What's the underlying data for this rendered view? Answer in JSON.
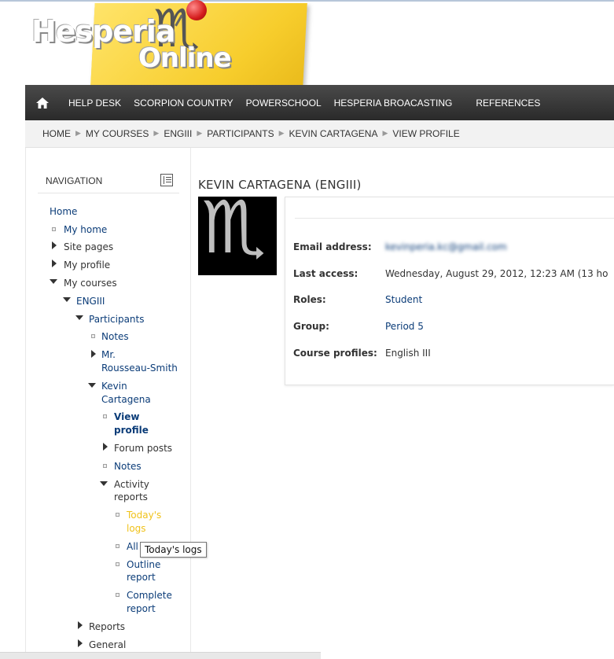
{
  "logo": {
    "line1": "Hesperia",
    "line2": "Online"
  },
  "navbar": {
    "items": [
      "HELP DESK",
      "SCORPION COUNTRY",
      "POWERSCHOOL",
      "HESPERIA BROACASTING",
      "REFERENCES"
    ]
  },
  "breadcrumb": [
    "HOME",
    "MY COURSES",
    "ENGIII",
    "PARTICIPANTS",
    "KEVIN CARTAGENA",
    "VIEW PROFILE"
  ],
  "navigation": {
    "title": "NAVIGATION",
    "items": {
      "home": "Home",
      "my_home": "My home",
      "site_pages": "Site pages",
      "my_profile": "My profile",
      "my_courses": "My courses",
      "engiii": "ENGIII",
      "participants": "Participants",
      "notes1": "Notes",
      "rousseau1": "Mr.",
      "rousseau2": "Rousseau-Smith",
      "kevin1": "Kevin",
      "kevin2": "Cartagena",
      "view_profile1": "View",
      "view_profile2": "profile",
      "forum_posts": "Forum posts",
      "notes2": "Notes",
      "activity1": "Activity",
      "activity2": "reports",
      "todays1": "Today's",
      "todays2": "logs",
      "all": "All",
      "outline1": "Outline",
      "outline2": "report",
      "complete1": "Complete",
      "complete2": "report",
      "reports": "Reports",
      "general": "General"
    }
  },
  "tooltip": "Today's logs",
  "profile": {
    "heading": "KEVIN CARTAGENA (ENGIII)",
    "rows": [
      {
        "label": "Email address:",
        "value": "kevinperia.kc@gmail.com"
      },
      {
        "label": "Last access:",
        "value": "Wednesday, August 29, 2012, 12:23 AM  (13 ho"
      },
      {
        "label": "Roles:",
        "value": "Student"
      },
      {
        "label": "Group:",
        "value": "Period 5"
      },
      {
        "label": "Course profiles:",
        "value": "English III"
      }
    ]
  },
  "colors": {
    "navbar": "#333333",
    "link": "#0b3c78",
    "active": "#f0c21a",
    "sticky_note": "#f9d53e"
  },
  "icons": {
    "home": "home-icon",
    "dock": "dock-block-icon",
    "pin": "pushpin-icon",
    "scorpion": "scorpion-icon"
  }
}
